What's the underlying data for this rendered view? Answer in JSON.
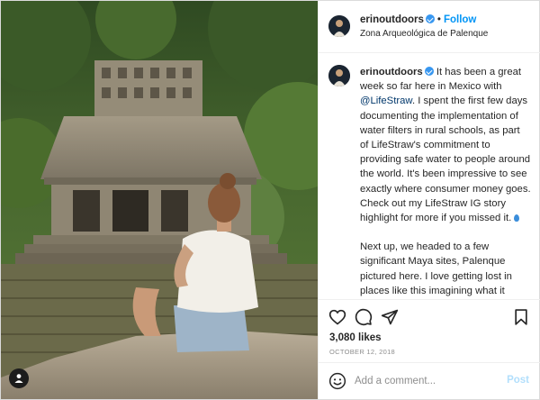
{
  "header": {
    "username": "erinoutdoors",
    "separator": "•",
    "follow_label": "Follow",
    "location": "Zona Arqueológica de Palenque"
  },
  "caption": {
    "username": "erinoutdoors",
    "p1_a": "It has been a great week so far here in Mexico with",
    "mention": "@LifeStraw",
    "p1_b": ". I spent the first few days documenting the implementation of water filters in rural schools, as part of LifeStraw's commitment to providing safe water to people around the world. It's been impressive to see exactly where consumer money goes. Check out my LifeStraw IG story highlight for more if you missed it.",
    "p2": "Next up, we headed to a few significant Maya sites, Palenque pictured here. I love getting lost in places like this imagining what it would have looked like in its day. Looking forward to seeing more of Chiapas this week."
  },
  "stats": {
    "likes": "3,080 likes",
    "date": "OCTOBER 12, 2018"
  },
  "comment": {
    "placeholder": "Add a comment...",
    "post_label": "Post"
  },
  "icons": {
    "like": "heart-icon",
    "comment": "comment-icon",
    "share": "paper-plane-icon",
    "save": "bookmark-icon",
    "emoji": "smiley-icon",
    "tags": "user-tag-icon",
    "verified": "verified-badge-icon"
  },
  "colors": {
    "follow": "#0095f6",
    "verified": "#3897f0",
    "mention": "#00376b",
    "post_disabled": "#b2dffc",
    "muted": "#8e8e8e"
  }
}
